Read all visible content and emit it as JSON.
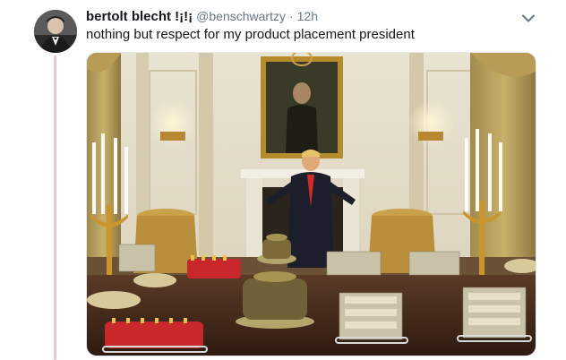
{
  "tweet": {
    "display_name": "bertolt blecht !¡!¡",
    "handle": "@benschwartzy",
    "separator": "·",
    "timestamp": "12h",
    "text": "nothing but respect for my product placement president",
    "avatar_icon": "profile-photo-icon",
    "menu_icon": "chevron-down-icon",
    "media_description_icon": "photo"
  },
  "colors": {
    "name": "#14171a",
    "meta": "#657786",
    "thread_line": "#e8c6d6",
    "card_border": "#e1e8ed"
  }
}
